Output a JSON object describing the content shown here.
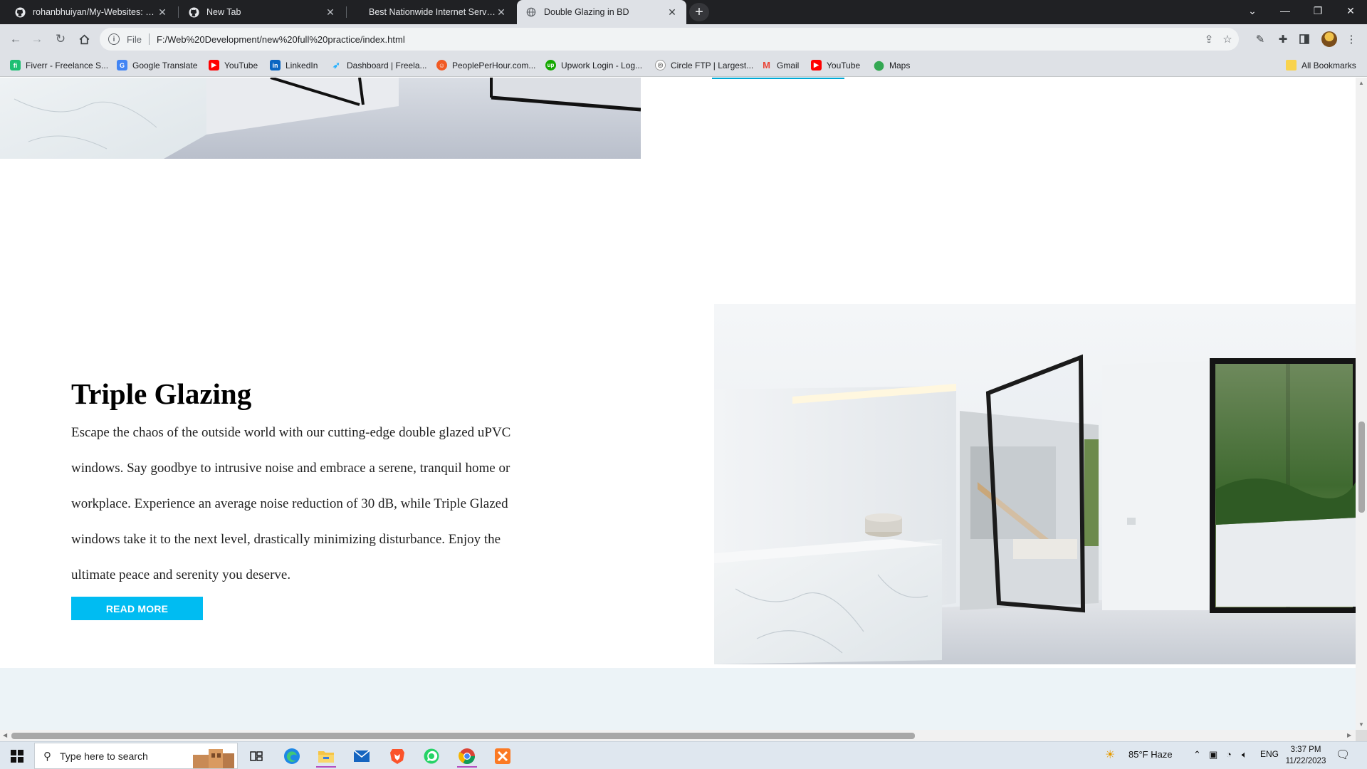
{
  "browser": {
    "tabs": [
      {
        "title": "rohanbhuiyan/My-Websites: I ha",
        "icon": "github-icon",
        "active": false
      },
      {
        "title": "New Tab",
        "icon": "github-icon",
        "active": false
      },
      {
        "title": "Best Nationwide Internet Service",
        "icon": "",
        "active": false
      },
      {
        "title": "Double Glazing in BD",
        "icon": "globe-icon",
        "active": true
      }
    ],
    "address": {
      "scheme_label": "File",
      "url": "F:/Web%20Development/new%20full%20practice/index.html"
    },
    "bookmarks": [
      {
        "label": "Fiverr - Freelance S...",
        "icon": "fiverr-icon",
        "color": "#1dbf73"
      },
      {
        "label": "Google Translate",
        "icon": "translate-icon",
        "color": "#4285f4"
      },
      {
        "label": "YouTube",
        "icon": "youtube-icon",
        "color": "#ff0000"
      },
      {
        "label": "LinkedIn",
        "icon": "linkedin-icon",
        "color": "#0a66c2"
      },
      {
        "label": "Dashboard | Freela...",
        "icon": "freelancer-icon",
        "color": "#29b2fe"
      },
      {
        "label": "PeoplePerHour.com...",
        "icon": "peopleperhour-icon",
        "color": "#f15a24"
      },
      {
        "label": "Upwork Login - Log...",
        "icon": "upwork-icon",
        "color": "#14a800"
      },
      {
        "label": "Circle FTP | Largest...",
        "icon": "circleftp-icon",
        "color": "#888888"
      },
      {
        "label": "Gmail",
        "icon": "gmail-icon",
        "color": "#ea4335"
      },
      {
        "label": "YouTube",
        "icon": "youtube-icon",
        "color": "#ff0000"
      },
      {
        "label": "Maps",
        "icon": "maps-icon",
        "color": "#34a853"
      }
    ],
    "all_bookmarks_label": "All Bookmarks"
  },
  "page": {
    "section_heading": "Triple Glazing",
    "section_paragraph": "Escape the chaos of the outside world with our cutting-edge double glazed uPVC windows. Say goodbye to intrusive noise and embrace a serene, tranquil home or workplace. Experience an average noise reduction of 30 dB, while Triple Glazed windows take it to the next level, drastically minimizing disturbance. Enjoy the ultimate peace and serenity you deserve.",
    "read_more_label": "READ MORE",
    "accent_color": "#00bcf2"
  },
  "taskbar": {
    "search_placeholder": "Type here to search",
    "weather": "85°F  Haze",
    "language": "ENG",
    "time": "3:37 PM",
    "date": "11/22/2023"
  }
}
